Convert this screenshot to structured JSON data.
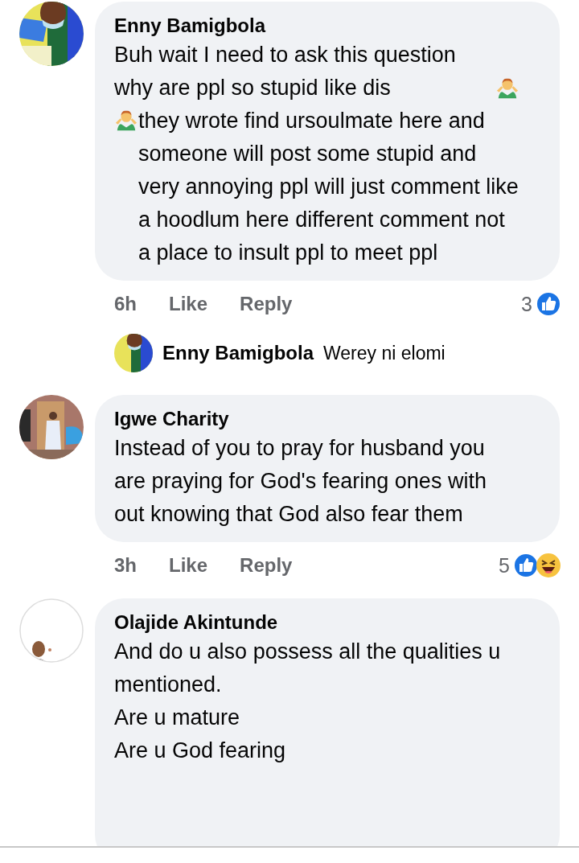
{
  "comments": [
    {
      "author": "Enny Bamigbola",
      "body": [
        {
          "kind": "text",
          "text": "Buh wait I need to ask this question why are ppl so stupid like dis"
        },
        {
          "kind": "emoji"
        },
        {
          "kind": "emoji"
        },
        {
          "kind": "text",
          "text": "they wrote find ursoulmate here and someone will post some stupid and very annoying ppl will just comment like a hoodlum here different comment not a place to insult ppl to meet ppl"
        }
      ],
      "time": "6h",
      "actions": [
        "Like",
        "Reply"
      ],
      "reaction_count": "3",
      "reactions": [
        {
          "kind": "like"
        }
      ],
      "replies": [
        {
          "author": "Enny Bamigbola",
          "text": "Werey ni elomi"
        }
      ]
    },
    {
      "author": "Igwe Charity",
      "body": [
        {
          "kind": "text",
          "text": "Instead of you to pray for husband you are praying for God's fearing ones with out knowing that God also fear them"
        }
      ],
      "time": "3h",
      "actions": [
        "Like",
        "Reply"
      ],
      "reaction_count": "5",
      "reactions": [
        {
          "kind": "like"
        },
        {
          "kind": "haha"
        }
      ]
    },
    {
      "author": "Olajide Akintunde",
      "body": [
        {
          "kind": "text",
          "text": "And do u also possess all the qualities u mentioned.\nAre u mature\nAre u God fearing"
        }
      ]
    }
  ]
}
